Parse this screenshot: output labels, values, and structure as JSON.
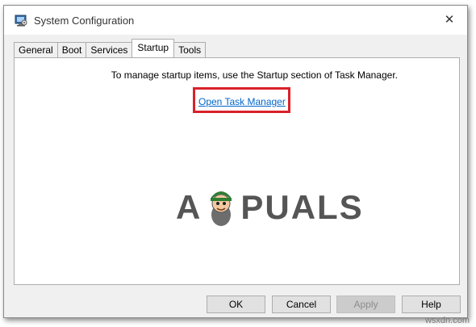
{
  "window": {
    "title": "System Configuration",
    "close_glyph": "✕"
  },
  "tabs": [
    {
      "label": "General"
    },
    {
      "label": "Boot"
    },
    {
      "label": "Services"
    },
    {
      "label": "Startup",
      "active": true
    },
    {
      "label": "Tools"
    }
  ],
  "startup": {
    "info_text": "To manage startup items, use the Startup section of Task Manager.",
    "link_label": "Open Task Manager",
    "highlight_color": "#d9212a"
  },
  "buttons": {
    "ok": "OK",
    "cancel": "Cancel",
    "apply": "Apply",
    "help": "Help"
  },
  "watermark": {
    "left_text": "A",
    "right_text": "PUALS"
  },
  "site_watermark": "wsxdn.com",
  "colors": {
    "link": "#0066cc",
    "window_bg": "#f0f0f0",
    "panel_bg": "#ffffff"
  }
}
